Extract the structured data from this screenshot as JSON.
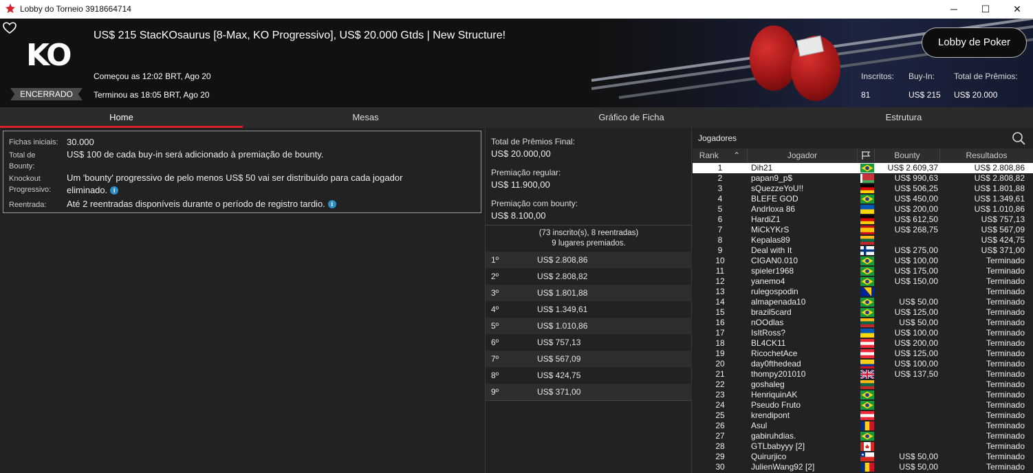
{
  "window": {
    "title": "Lobby do Torneio 3918664714",
    "minimize": "─",
    "maximize": "☐",
    "close": "✕"
  },
  "header": {
    "logo_text": "KO",
    "status": "ENCERRADO",
    "tournament_name": "US$ 215 StacKOsaurus [8-Max, KO Progressivo], US$ 20.000 Gtds | New Structure!",
    "started": "Começou as 12:02 BRT, Ago 20",
    "ended": "Terminou as 18:05 BRT, Ago 20",
    "lobby_button": "Lobby de Poker",
    "stats": [
      {
        "label": "Inscritos:",
        "value": "81"
      },
      {
        "label": "Buy-In:",
        "value": "US$ 215"
      },
      {
        "label": "Total de Prêmios:",
        "value": "US$ 20.000"
      }
    ]
  },
  "tabs": [
    "Home",
    "Mesas",
    "Gráfico de Ficha",
    "Estrutura"
  ],
  "info": {
    "rows": [
      {
        "label": "Fichas iniciais:",
        "value": "30.000"
      },
      {
        "label": "Total de Bounty:",
        "value": "US$ 100 de cada buy-in será adicionado à premiação de bounty."
      },
      {
        "label": "Knockout Progressivo:",
        "value": "Um 'bounty' progressivo de pelo menos US$ 50 vai ser distribuído para cada jogador eliminado."
      },
      {
        "label": "Reentrada:",
        "value": "Até 2 reentradas disponíveis durante o período de registro tardio."
      }
    ]
  },
  "prizes": {
    "total_label": "Total de Prêmios Final:",
    "total_value": "US$ 20.000,00",
    "regular_label": "Premiação regular:",
    "regular_value": "US$ 11.900,00",
    "bounty_label": "Premiação com bounty:",
    "bounty_value": "US$ 8.100,00",
    "summary_1": "(73 inscrito(s), 8 reentradas)",
    "summary_2": "9 lugares premiados.",
    "payouts": [
      {
        "pos": "1º",
        "amount": "US$ 2.808,86"
      },
      {
        "pos": "2º",
        "amount": "US$ 2.808,82"
      },
      {
        "pos": "3º",
        "amount": "US$ 1.801,88"
      },
      {
        "pos": "4º",
        "amount": "US$ 1.349,61"
      },
      {
        "pos": "5º",
        "amount": "US$ 1.010,86"
      },
      {
        "pos": "6º",
        "amount": "US$ 757,13"
      },
      {
        "pos": "7º",
        "amount": "US$ 567,09"
      },
      {
        "pos": "8º",
        "amount": "US$ 424,75"
      },
      {
        "pos": "9º",
        "amount": "US$ 371,00"
      }
    ]
  },
  "players": {
    "title": "Jogadores",
    "columns": {
      "rank": "Rank",
      "name": "Jogador",
      "bounty": "Bounty",
      "results": "Resultados"
    },
    "rows": [
      {
        "rank": "1",
        "name": "Dih21",
        "flag": "br",
        "bounty": "US$ 2.609,37",
        "result": "US$ 2.808,86"
      },
      {
        "rank": "2",
        "name": "papan9_p$",
        "flag": "by",
        "bounty": "US$ 990,63",
        "result": "US$ 2.808,82"
      },
      {
        "rank": "3",
        "name": "sQuezzeYoU!!",
        "flag": "de",
        "bounty": "US$ 506,25",
        "result": "US$ 1.801,88"
      },
      {
        "rank": "4",
        "name": "BLEFE GOD",
        "flag": "br",
        "bounty": "US$ 450,00",
        "result": "US$ 1.349,61"
      },
      {
        "rank": "5",
        "name": "Andrloxa 86",
        "flag": "ua",
        "bounty": "US$ 200,00",
        "result": "US$ 1.010,86"
      },
      {
        "rank": "6",
        "name": "HardiZ1",
        "flag": "de",
        "bounty": "US$ 612,50",
        "result": "US$ 757,13"
      },
      {
        "rank": "7",
        "name": "MiCkYKrS",
        "flag": "es",
        "bounty": "US$ 268,75",
        "result": "US$ 567,09"
      },
      {
        "rank": "8",
        "name": "Kepalas89",
        "flag": "lt",
        "bounty": "",
        "result": "US$ 424,75"
      },
      {
        "rank": "9",
        "name": "Deal with It",
        "flag": "fi",
        "bounty": "US$ 275,00",
        "result": "US$ 371,00"
      },
      {
        "rank": "10",
        "name": "CIGAN0.010",
        "flag": "br",
        "bounty": "US$ 100,00",
        "result": "Terminado"
      },
      {
        "rank": "11",
        "name": "spieler1968",
        "flag": "br",
        "bounty": "US$ 175,00",
        "result": "Terminado"
      },
      {
        "rank": "12",
        "name": "yanemo4",
        "flag": "br",
        "bounty": "US$ 150,00",
        "result": "Terminado"
      },
      {
        "rank": "13",
        "name": "rulegospodin",
        "flag": "ba",
        "bounty": "",
        "result": "Terminado"
      },
      {
        "rank": "14",
        "name": "almapenada10",
        "flag": "br",
        "bounty": "US$ 50,00",
        "result": "Terminado"
      },
      {
        "rank": "15",
        "name": "brazil5card",
        "flag": "br",
        "bounty": "US$ 125,00",
        "result": "Terminado"
      },
      {
        "rank": "16",
        "name": "nOOdlas",
        "flag": "lt",
        "bounty": "US$ 50,00",
        "result": "Terminado"
      },
      {
        "rank": "17",
        "name": "IsItRoss?",
        "flag": "ua",
        "bounty": "US$ 100,00",
        "result": "Terminado"
      },
      {
        "rank": "18",
        "name": "BL4CK11",
        "flag": "at",
        "bounty": "US$ 200,00",
        "result": "Terminado"
      },
      {
        "rank": "19",
        "name": "RicochetAce",
        "flag": "at",
        "bounty": "US$ 125,00",
        "result": "Terminado"
      },
      {
        "rank": "20",
        "name": "day0fthedead",
        "flag": "co",
        "bounty": "US$ 100,00",
        "result": "Terminado"
      },
      {
        "rank": "21",
        "name": "thompy201010",
        "flag": "gb",
        "bounty": "US$ 137,50",
        "result": "Terminado"
      },
      {
        "rank": "22",
        "name": "goshaleg",
        "flag": "lt",
        "bounty": "",
        "result": "Terminado"
      },
      {
        "rank": "23",
        "name": "HenriquinAK",
        "flag": "br",
        "bounty": "",
        "result": "Terminado"
      },
      {
        "rank": "24",
        "name": "Pseudo Fruto",
        "flag": "br",
        "bounty": "",
        "result": "Terminado"
      },
      {
        "rank": "25",
        "name": "krendipont",
        "flag": "at",
        "bounty": "",
        "result": "Terminado"
      },
      {
        "rank": "26",
        "name": "Asul",
        "flag": "ro",
        "bounty": "",
        "result": "Terminado"
      },
      {
        "rank": "27",
        "name": "gabiruhdias.",
        "flag": "br",
        "bounty": "",
        "result": "Terminado"
      },
      {
        "rank": "28",
        "name": "GTLbabyyy [2]",
        "flag": "ca",
        "bounty": "",
        "result": "Terminado"
      },
      {
        "rank": "29",
        "name": "Quirurjico",
        "flag": "cl",
        "bounty": "US$ 50,00",
        "result": "Terminado"
      },
      {
        "rank": "30",
        "name": "JulienWang92 [2]",
        "flag": "ro",
        "bounty": "US$ 50,00",
        "result": "Terminado"
      }
    ]
  },
  "colors": {
    "accent": "#d9202a",
    "background": "#222222",
    "info": "#2a8fc7"
  }
}
